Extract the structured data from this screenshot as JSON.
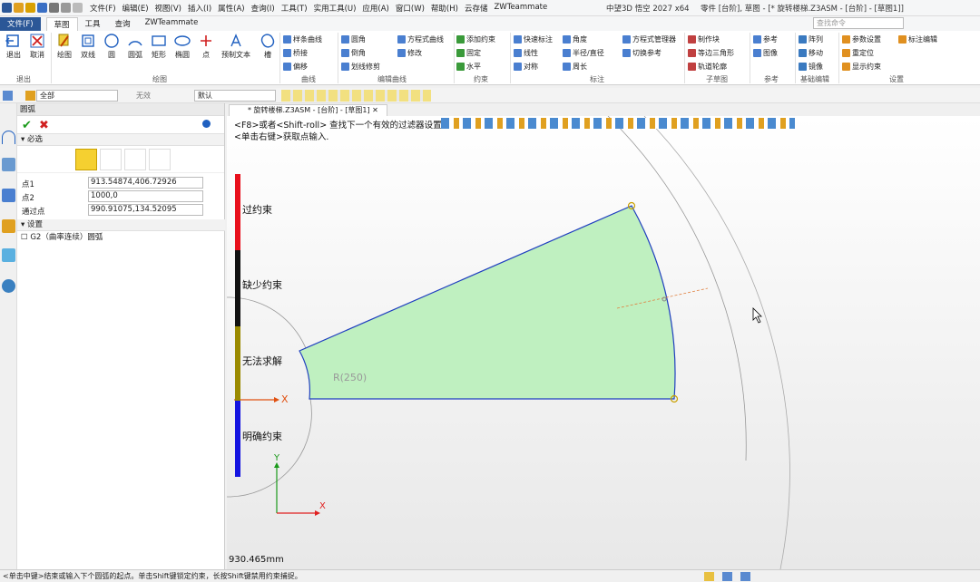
{
  "app": {
    "title": "中望3D 悟空 2027 x64",
    "document": "零件 [台阶], 草图 - [* 旋转楼梯.Z3ASM - [台阶] - [草图1]]"
  },
  "menubar": {
    "items": [
      "文件(F)",
      "编辑(E)",
      "视图(V)",
      "插入(I)",
      "属性(A)",
      "查询(I)",
      "工具(T)",
      "实用工具(U)",
      "应用(A)",
      "窗口(W)",
      "帮助(H)",
      "云存储",
      "ZWTeammate"
    ]
  },
  "ribbon_tabs": [
    "文件(F)",
    "草图",
    "工具",
    "查询",
    "ZWTeammate"
  ],
  "search": {
    "placeholder": "查找命令"
  },
  "ribbon": {
    "big_buttons": [
      {
        "label": "退出"
      },
      {
        "label": "取消"
      },
      {
        "label": "绘图"
      },
      {
        "label": "双线"
      },
      {
        "label": "圆"
      },
      {
        "label": "圆弧"
      },
      {
        "label": "矩形"
      },
      {
        "label": "椭圆"
      },
      {
        "label": "点"
      },
      {
        "label": "预制文本"
      },
      {
        "label": "槽"
      }
    ],
    "small_items": [
      "样条曲线",
      "桥接",
      "偏移",
      "圆角",
      "倒角",
      "划线修剪",
      "方程式曲线",
      "修改",
      "添加约束",
      "固定",
      "水平",
      "快速标注",
      "线性",
      "对称",
      "角度",
      "半径/直径",
      "周长",
      "方程式管理器",
      "切换参考",
      "制作块",
      "等边三角形",
      "轨道轮廓",
      "参考",
      "图像",
      "阵列",
      "移动",
      "镜像",
      "参数设置",
      "重定位",
      "显示约束",
      "标注编辑"
    ],
    "groups": [
      "退出",
      "绘图",
      "曲线",
      "编辑曲线",
      "约束",
      "标注",
      "子草图",
      "参考",
      "基础编辑",
      "设置"
    ]
  },
  "filterbar": {
    "filter_value": "全部",
    "field2": "无效",
    "layer_value": "默认"
  },
  "panel": {
    "title": "圆弧",
    "section_required": "必选",
    "fields": [
      {
        "label": "点1",
        "value": "913.54874,406.72926"
      },
      {
        "label": "点2",
        "value": "1000,0"
      },
      {
        "label": "通过点",
        "value": "990.91075,134.52095"
      }
    ],
    "section_settings": "设置",
    "g2_option": "G2（曲率连续）圆弧"
  },
  "doctab": {
    "label": "* 旋转楼梯.Z3ASM - [台阶] - [草图1]"
  },
  "viewport": {
    "prompt1": "<F8>或者<Shift-roll> 查找下一个有效的过滤器设置.",
    "prompt2": "<单击右键>获取点输入.",
    "status_labels": [
      {
        "text": "过约束",
        "color": "#e8101c"
      },
      {
        "text": "缺少约束",
        "color": "#111111"
      },
      {
        "text": "无法求解",
        "color": "#9a8a00"
      },
      {
        "text": "明确约束",
        "color": "#1414e0"
      }
    ],
    "radius_label": "R(250)",
    "x_axis": "X",
    "y_axis": "Y",
    "dimension": "930.465mm",
    "fill_color": "#bff0c0"
  },
  "statusbar": {
    "text": "<单击中键>结束或输入下个圆弧的起点。单击Shift键锁定约束，长按Shift键禁用约束捕捉。"
  }
}
